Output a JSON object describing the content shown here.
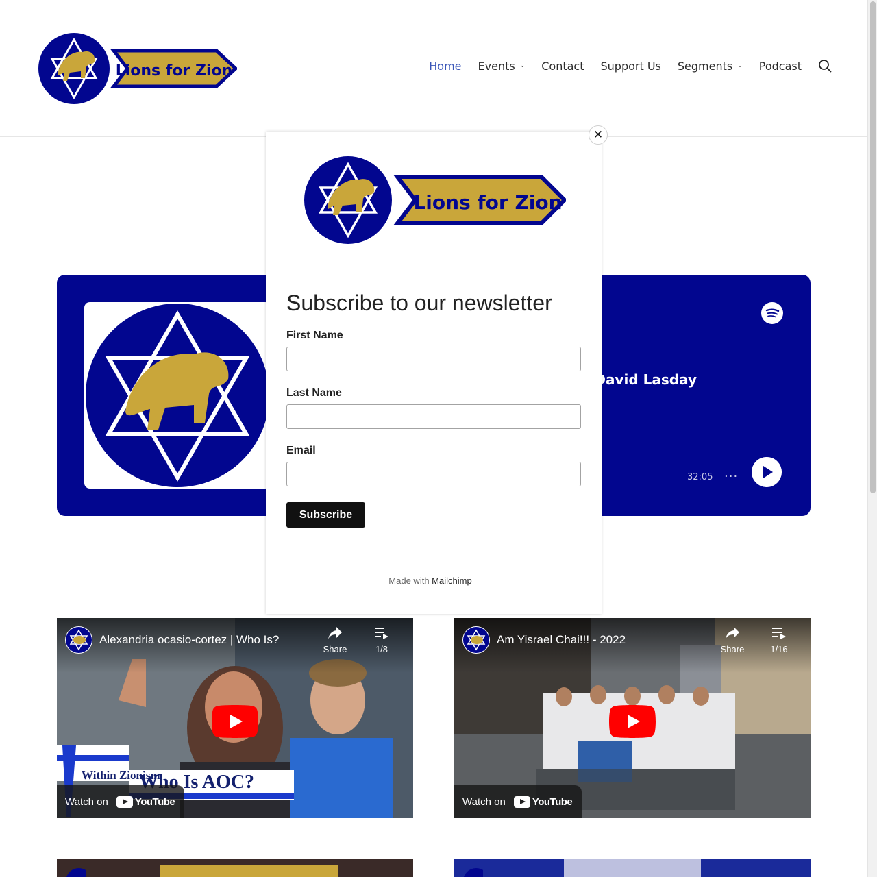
{
  "header": {
    "logo_text": "Lions for Zion",
    "nav": [
      {
        "label": "Home",
        "active": true,
        "has_dropdown": false
      },
      {
        "label": "Events",
        "active": false,
        "has_dropdown": true
      },
      {
        "label": "Contact",
        "active": false,
        "has_dropdown": false
      },
      {
        "label": "Support Us",
        "active": false,
        "has_dropdown": false
      },
      {
        "label": "Segments",
        "active": false,
        "has_dropdown": true
      },
      {
        "label": "Podcast",
        "active": false,
        "has_dropdown": false
      }
    ],
    "search_icon": "search-icon"
  },
  "spotify": {
    "episode_title_partial": "sse David Lasday",
    "duration": "32:05",
    "more": "···"
  },
  "modal": {
    "logo_text": "Lions for Zion",
    "close": "✕",
    "heading": "Subscribe to our newsletter",
    "fields": [
      {
        "label": "First Name",
        "value": ""
      },
      {
        "label": "Last Name",
        "value": ""
      },
      {
        "label": "Email",
        "value": ""
      }
    ],
    "subscribe_label": "Subscribe",
    "made_with": "Made with",
    "made_with_brand": "Mailchimp"
  },
  "videos": [
    {
      "title": "Alexandria ocasio-cortez | Who Is?",
      "share": "Share",
      "count": "1/8",
      "watch_on": "Watch on",
      "yt": "YouTube",
      "thumb_text_1": "Within Zionism",
      "thumb_text_2": "Who Is AOC?"
    },
    {
      "title": "Am Yisrael Chai!!! - 2022",
      "share": "Share",
      "count": "1/16",
      "watch_on": "Watch on",
      "yt": "YouTube"
    }
  ],
  "colors": {
    "brand_blue": "#02068f",
    "brand_gold": "#c9a63a",
    "nav_active": "#3a56b8",
    "yt_red": "#ff0000"
  }
}
